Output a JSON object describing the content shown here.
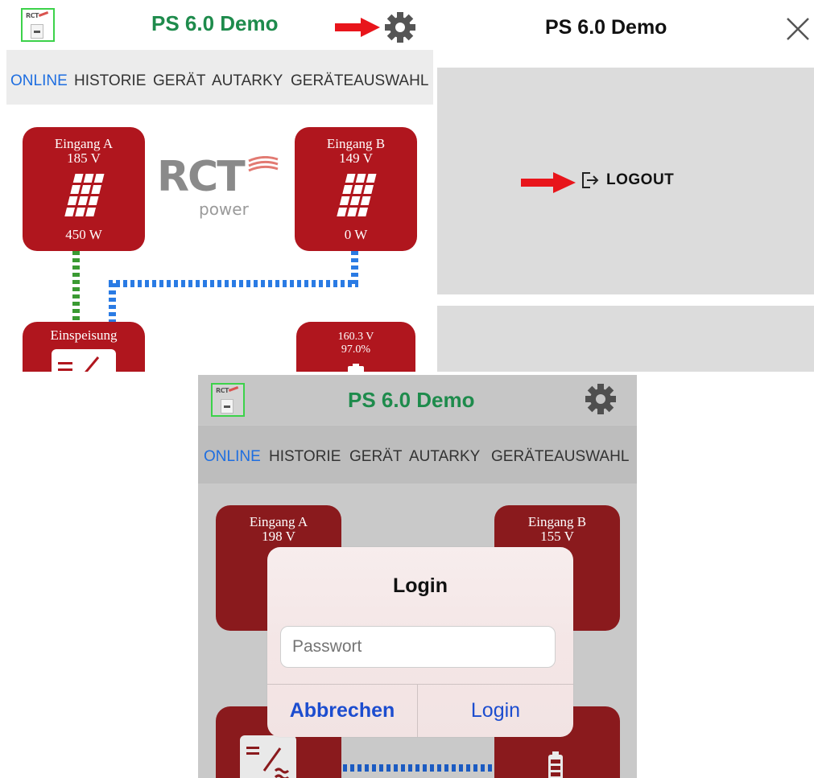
{
  "app": {
    "title": "PS 6.0 Demo",
    "title_color": "#1e8b4c",
    "accent_red": "#b0161e"
  },
  "tabs": [
    "ONLINE",
    "HISTORIE",
    "GERÄT",
    "AUTARKY",
    "GERÄTEAUSWAHL"
  ],
  "active_tab": "ONLINE",
  "brand": {
    "name": "RCT",
    "sub": "power"
  },
  "screen1": {
    "eingang_a": {
      "label": "Eingang A",
      "voltage": "185 V",
      "power": "450 W"
    },
    "eingang_b": {
      "label": "Eingang B",
      "voltage": "149 V",
      "power": "0 W"
    },
    "einspeisung": {
      "label": "Einspeisung"
    },
    "battery": {
      "voltage": "160.3 V",
      "soc": "97.0%"
    }
  },
  "screen2": {
    "title": "PS 6.0 Demo",
    "logout_label": "LOGOUT",
    "icons": [
      "close-icon",
      "logout-icon"
    ]
  },
  "screen3": {
    "eingang_a": {
      "label": "Eingang A",
      "voltage": "198 V"
    },
    "eingang_b": {
      "label": "Eingang B",
      "voltage": "155 V"
    },
    "dialog": {
      "title": "Login",
      "password_placeholder": "Passwort",
      "cancel_label": "Abbrechen",
      "login_label": "Login"
    }
  },
  "icons": [
    "gear-icon",
    "solar-panel-icon",
    "inverter-icon",
    "battery-icon",
    "red-arrow-icon"
  ]
}
